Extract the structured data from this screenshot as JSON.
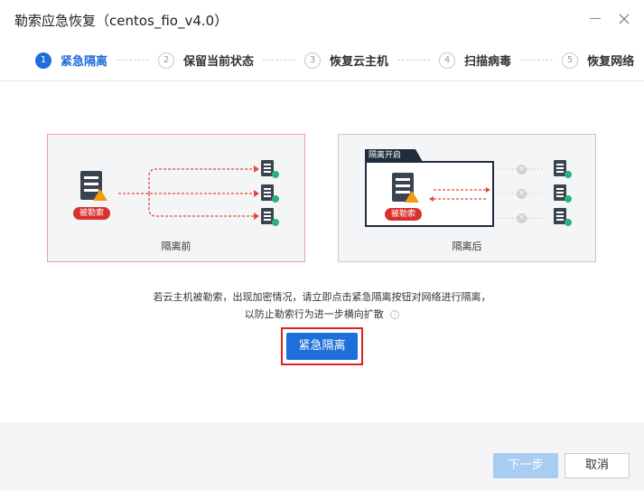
{
  "dialog": {
    "title": "勒索应急恢复（centos_fio_v4.0）"
  },
  "steps": [
    {
      "num": "1",
      "label": "紧急隔离",
      "active": true
    },
    {
      "num": "2",
      "label": "保留当前状态"
    },
    {
      "num": "3",
      "label": "恢复云主机"
    },
    {
      "num": "4",
      "label": "扫描病毒"
    },
    {
      "num": "5",
      "label": "恢复网络"
    }
  ],
  "diagram_before": {
    "badge": "被勒索",
    "caption": "隔离前"
  },
  "diagram_after": {
    "tab": "隔离开启",
    "badge": "被勒索",
    "caption": "隔离后"
  },
  "description": {
    "line1": "若云主机被勒索，出现加密情况，请立即点击紧急隔离按钮对网络进行隔离，",
    "line2": "以防止勒索行为进一步横向扩散"
  },
  "actions": {
    "isolate_label": "紧急隔离",
    "next_label": "下一步",
    "cancel_label": "取消"
  },
  "colors": {
    "accent": "#1e6fd9",
    "danger": "#d9322e",
    "highlight": "#e02020"
  }
}
